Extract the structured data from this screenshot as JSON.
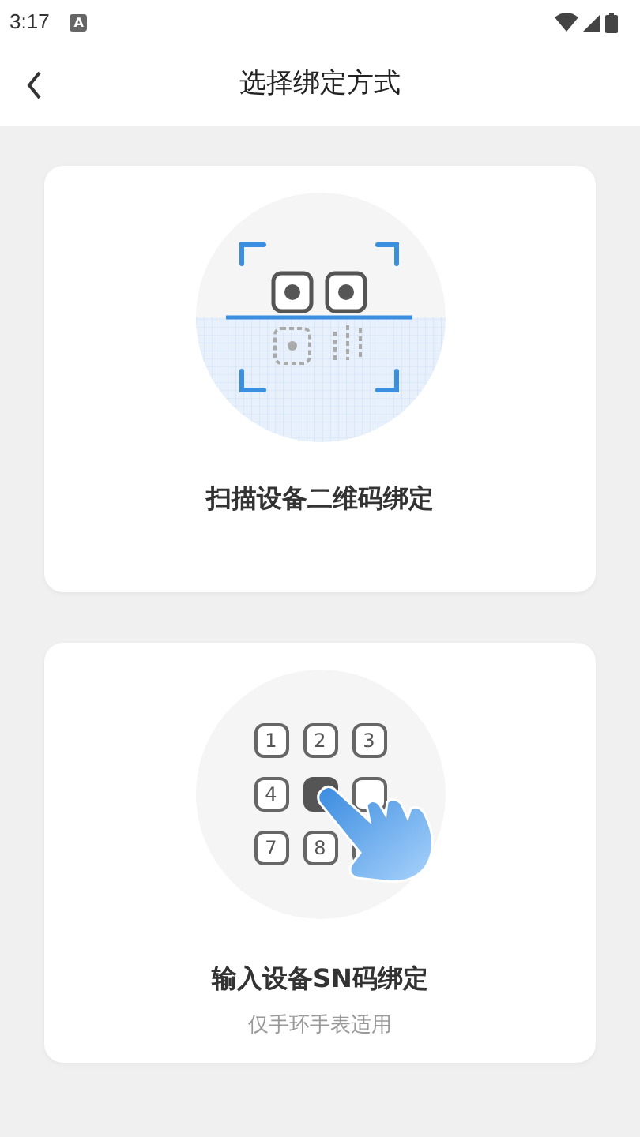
{
  "status_bar": {
    "time": "3:17",
    "notification": "A"
  },
  "header": {
    "title": "选择绑定方式"
  },
  "options": [
    {
      "kind": "scan",
      "title": "扫描设备二维码绑定"
    },
    {
      "kind": "keypad",
      "title": "输入设备SN码绑定",
      "subtitle": "仅手环手表适用",
      "keys": [
        {
          "label": "1",
          "selected": false
        },
        {
          "label": "2",
          "selected": false
        },
        {
          "label": "3",
          "selected": false
        },
        {
          "label": "4",
          "selected": false
        },
        {
          "selected": true
        },
        {
          "selected": false
        },
        {
          "label": "7",
          "selected": false
        },
        {
          "label": "8",
          "selected": false
        },
        {
          "selected": false
        }
      ]
    }
  ]
}
